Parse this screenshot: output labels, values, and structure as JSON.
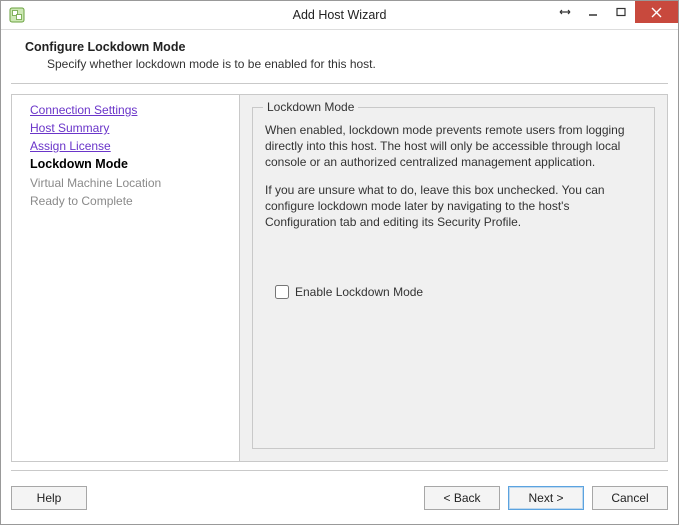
{
  "window": {
    "title": "Add Host Wizard"
  },
  "header": {
    "title": "Configure Lockdown Mode",
    "subtitle": "Specify whether lockdown mode is to be enabled for this host."
  },
  "sidebar": {
    "steps": [
      {
        "label": "Connection Settings",
        "state": "done"
      },
      {
        "label": "Host Summary",
        "state": "done"
      },
      {
        "label": "Assign License",
        "state": "done"
      },
      {
        "label": "Lockdown Mode",
        "state": "current"
      },
      {
        "label": "Virtual Machine Location",
        "state": "pending"
      },
      {
        "label": "Ready to Complete",
        "state": "pending"
      }
    ]
  },
  "group": {
    "legend": "Lockdown Mode",
    "para1": "When enabled, lockdown mode prevents remote users from logging directly into this host. The host will only be accessible through local console or an authorized centralized management application.",
    "para2": "If you are unsure what to do, leave this box unchecked. You can configure lockdown mode later by navigating to the host's Configuration tab and editing its Security Profile.",
    "checkbox_label": "Enable Lockdown Mode",
    "checkbox_checked": false
  },
  "footer": {
    "help": "Help",
    "back": "< Back",
    "next": "Next >",
    "cancel": "Cancel"
  }
}
